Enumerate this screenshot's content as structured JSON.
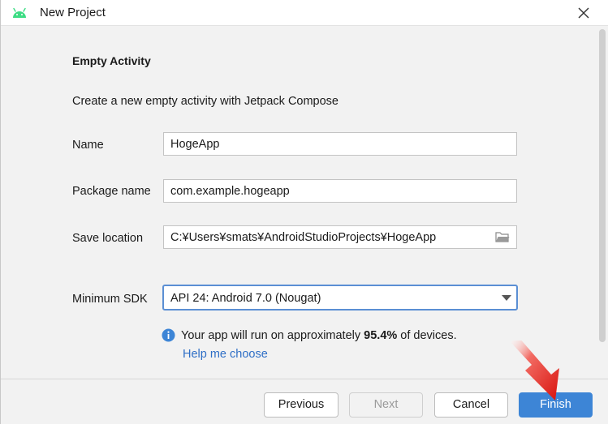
{
  "window": {
    "title": "New Project",
    "title_icon": "android-icon",
    "close_icon": "close-icon"
  },
  "template": {
    "heading": "Empty Activity",
    "description": "Create a new empty activity with Jetpack Compose"
  },
  "form": {
    "name": {
      "label": "Name",
      "value": "HogeApp"
    },
    "package_name": {
      "label": "Package name",
      "value": "com.example.hogeapp"
    },
    "save_location": {
      "label": "Save location",
      "value": "C:¥Users¥smats¥AndroidStudioProjects¥HogeApp",
      "browse_icon": "folder-icon"
    },
    "minimum_sdk": {
      "label": "Minimum SDK",
      "selected": "API 24: Android 7.0 (Nougat)"
    }
  },
  "info": {
    "icon": "info-icon",
    "text_before": "Your app will run on approximately ",
    "percentage": "95.4%",
    "text_after": " of devices.",
    "help_link": "Help me choose"
  },
  "buttons": {
    "previous": "Previous",
    "next": "Next",
    "cancel": "Cancel",
    "finish": "Finish"
  },
  "colors": {
    "accent": "#3d85d6",
    "link": "#2f6fc6",
    "android": "#3ddc84",
    "annotation_arrow": "#e8231e"
  }
}
